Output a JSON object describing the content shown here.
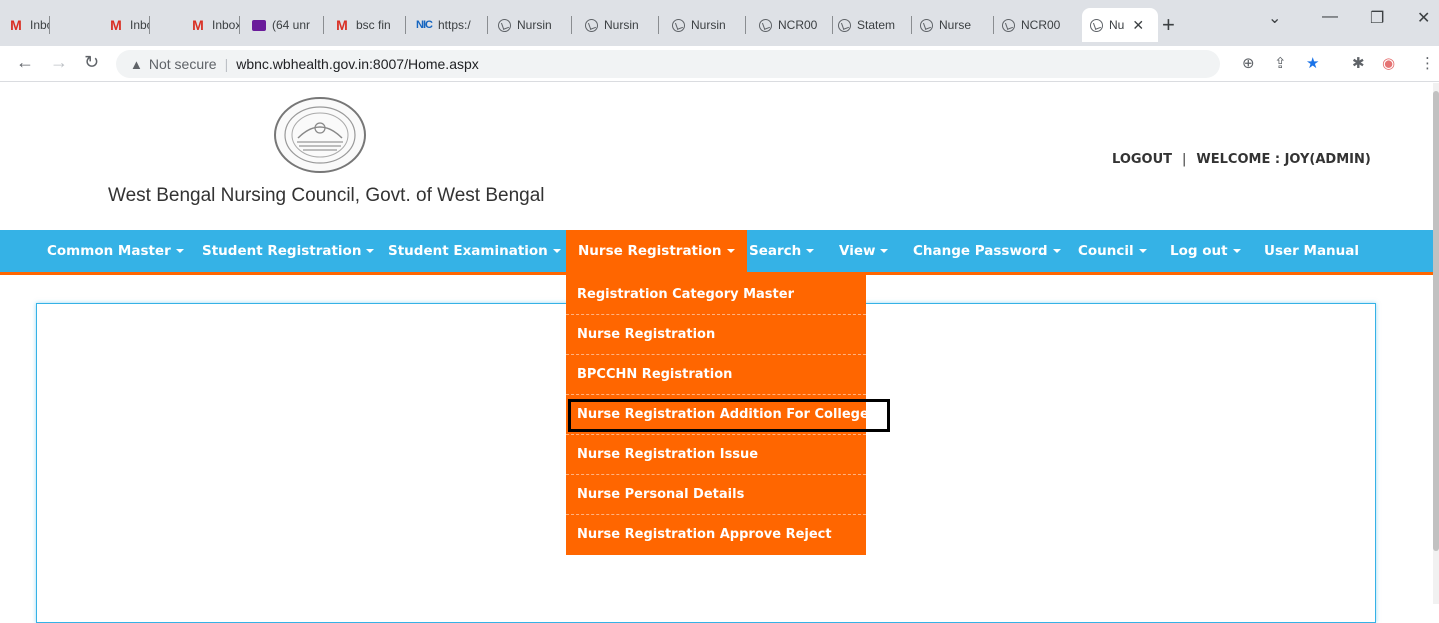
{
  "browser": {
    "tabs": [
      {
        "icon": "gmail-icon",
        "label": "Inbox ("
      },
      {
        "icon": "gmail-icon",
        "label": "Inbox ("
      },
      {
        "icon": "gmail-icon",
        "label": "Inbox ("
      },
      {
        "icon": "mail-icon",
        "label": "(64 unr"
      },
      {
        "icon": "gmail-icon",
        "label": "bsc fin"
      },
      {
        "icon": "nic-icon",
        "label": "https:/"
      },
      {
        "icon": "globe-icon",
        "label": "Nursin"
      },
      {
        "icon": "globe-icon",
        "label": "Nursin"
      },
      {
        "icon": "globe-icon",
        "label": "Nursin"
      },
      {
        "icon": "globe-icon",
        "label": "NCR00"
      },
      {
        "icon": "globe-icon",
        "label": "Statem"
      },
      {
        "icon": "globe-icon",
        "label": "Nurse"
      },
      {
        "icon": "globe-icon",
        "label": "NCR00"
      },
      {
        "icon": "globe-icon",
        "label": "Nu"
      }
    ],
    "security_label": "Not secure",
    "url": "wbnc.wbhealth.gov.in:8007/Home.aspx"
  },
  "header": {
    "site_title": "West Bengal Nursing Council, Govt. of West Bengal",
    "logout": "LOGOUT",
    "separator": "|",
    "welcome": "WELCOME : JOY(ADMIN)"
  },
  "menu": {
    "items": [
      "Common Master",
      "Student Registration",
      "Student Examination",
      "Nurse Registration",
      "Search",
      "View",
      "Change Password",
      "Council",
      "Log out",
      "User Manual"
    ]
  },
  "dropdown": {
    "items": [
      "Registration Category Master",
      "Nurse Registration",
      "BPCCHN Registration",
      "Nurse Registration Addition For College",
      "Nurse Registration Issue",
      "Nurse Personal Details",
      "Nurse Registration Approve Reject"
    ]
  },
  "colors": {
    "menu_bar": "#35b2e6",
    "accent": "#ff6600"
  }
}
